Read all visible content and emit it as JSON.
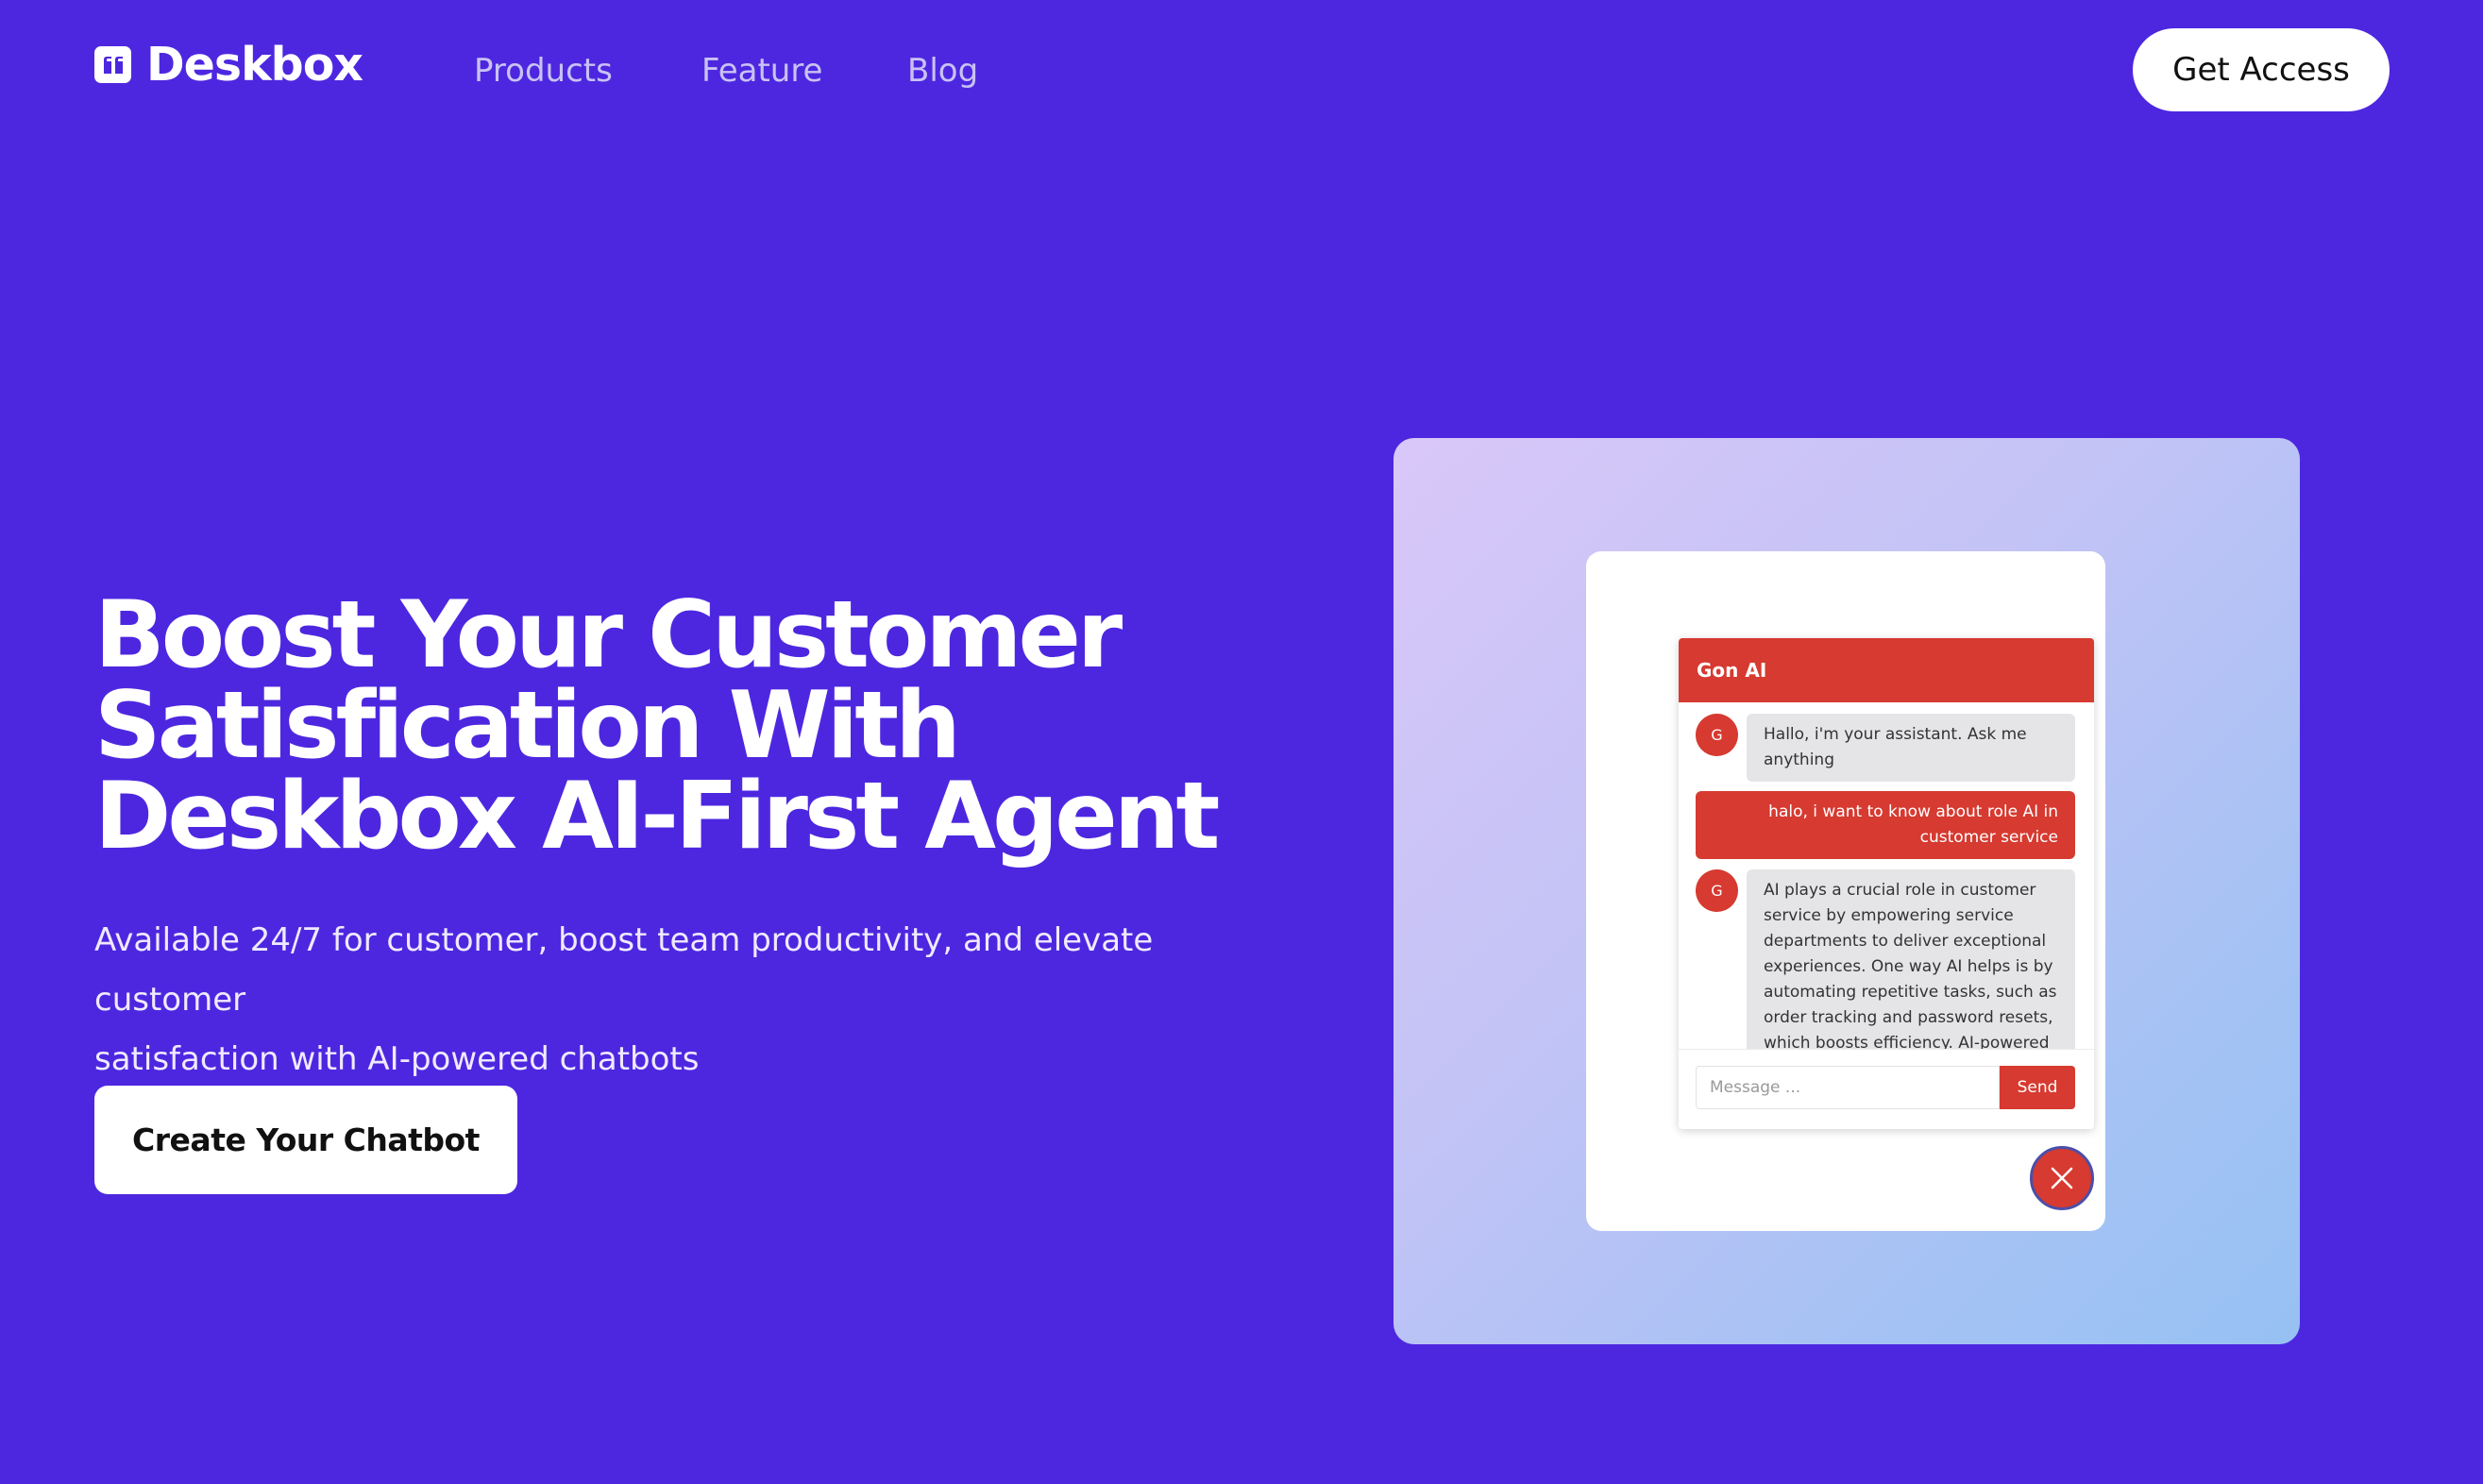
{
  "brand": {
    "name": "Deskbox",
    "logo_icon": "quote-icon"
  },
  "nav": {
    "items": [
      {
        "label": "Products"
      },
      {
        "label": "Feature"
      },
      {
        "label": "Blog"
      }
    ],
    "cta_label": "Get Access"
  },
  "hero": {
    "title_lines": [
      "Boost Your Customer",
      "Satisfication With",
      "Deskbox AI-First Agent"
    ],
    "subtitle_lines": [
      "Available 24/7 for customer, boost team productivity, and elevate customer",
      "satisfaction with AI-powered chatbots"
    ],
    "cta_label": "Create Your Chatbot"
  },
  "chat_widget": {
    "title": "Gon AI",
    "avatar_initial": "G",
    "messages": [
      {
        "from": "bot",
        "lines": [
          "Hallo, i'm your assistant. Ask me",
          "anything"
        ]
      },
      {
        "from": "user",
        "lines": [
          "halo, i want to know about role AI in",
          "customer service"
        ]
      },
      {
        "from": "bot",
        "lines": [
          "AI plays a crucial role in customer",
          "service by empowering service",
          "departments to deliver exceptional",
          "experiences. One way AI helps is by",
          "automating repetitive tasks, such as",
          "order tracking and password resets,",
          "which boosts efficiency. AI-powered"
        ]
      }
    ],
    "input_placeholder": "Message ...",
    "send_label": "Send",
    "close_icon": "close-icon"
  },
  "colors": {
    "background": "#4d27e0",
    "accent_red": "#d63a30",
    "white": "#ffffff"
  }
}
